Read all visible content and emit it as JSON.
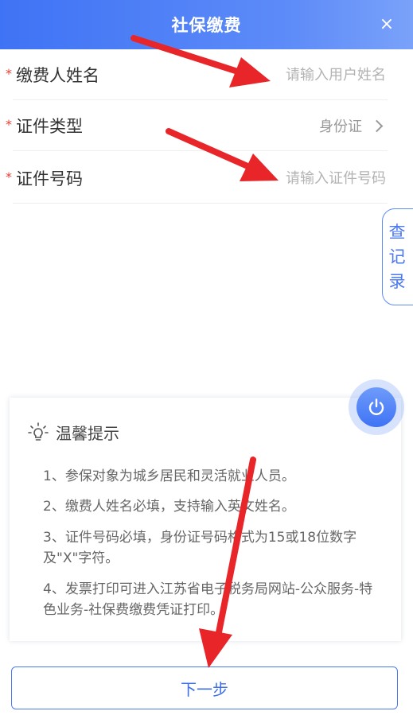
{
  "header": {
    "title": "社保缴费",
    "close_symbol": "×"
  },
  "form": {
    "required_mark": "*",
    "name": {
      "label": "缴费人姓名",
      "placeholder": "请输入用户姓名",
      "value": ""
    },
    "id_type": {
      "label": "证件类型",
      "value": "身份证"
    },
    "id_number": {
      "label": "证件号码",
      "placeholder": "请输入证件号码",
      "value": ""
    }
  },
  "record_tab": {
    "chars": [
      "查",
      "记",
      "录"
    ]
  },
  "tips": {
    "title": "温馨提示",
    "items": [
      "1、参保对象为城乡居民和灵活就业人员。",
      "2、缴费人姓名必填，支持输入英文姓名。",
      "3、证件号码必填，身份证号码格式为15或18位数字及\"X\"字符。",
      "4、发票打印可进入江苏省电子税务局网站-公众服务-特色业务-社保费缴费凭证打印。"
    ]
  },
  "next_button": {
    "label": "下一步"
  },
  "colors": {
    "primary": "#3f73f5",
    "required": "#e0413a",
    "annotation": "#e8262a"
  }
}
